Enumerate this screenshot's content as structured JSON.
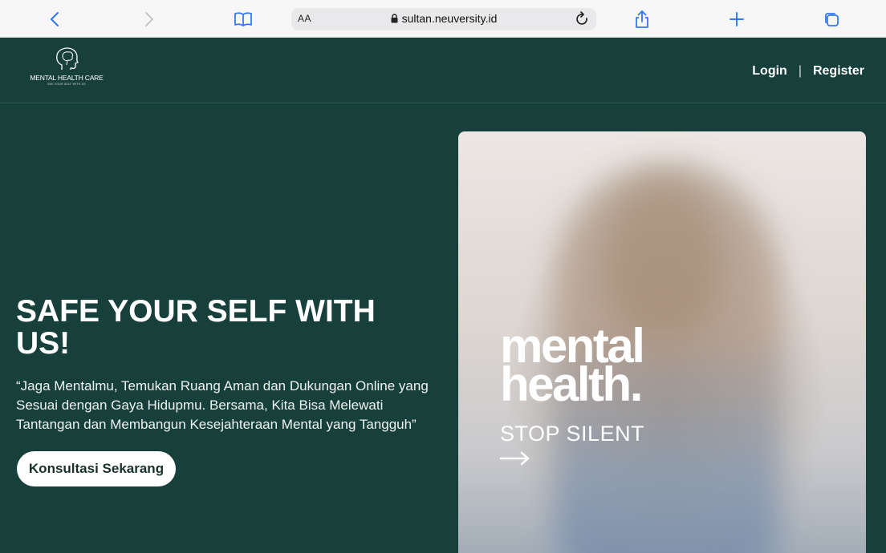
{
  "browser": {
    "text_size_label": "AA",
    "url": "sultan.neuversity.id"
  },
  "header": {
    "logo_name": "MENTAL HEALTH CARE",
    "logo_tagline": "SEE YOUR SELF WITH US",
    "login_label": "Login",
    "separator": "|",
    "register_label": "Register"
  },
  "hero": {
    "title": "SAFE YOUR SELF WITH US!",
    "quote": "“Jaga Mentalmu, Temukan Ruang Aman dan Dukungan Online yang Sesuai dengan Gaya Hidupmu. Bersama, Kita Bisa Melewati Tantangan dan Membangun Kesejahteraan Mental yang Tangguh”",
    "cta_label": "Konsultasi Sekarang"
  },
  "poster": {
    "line1": "mental",
    "line2": "health.",
    "line3": "STOP SILENT"
  },
  "colors": {
    "background": "#17403a",
    "chrome": "#f7f7f8",
    "accent": "#3478f6",
    "cta_bg": "#ffffff"
  }
}
